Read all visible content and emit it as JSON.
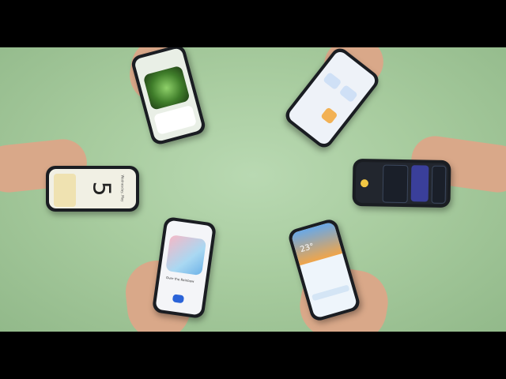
{
  "scene": {
    "description_label": "six-phones-on-green-background",
    "background_color": "#a9cda0",
    "letterbox_color": "#000000"
  },
  "phones": {
    "clock": {
      "big_digit": "5",
      "label": "Wednesday, May"
    },
    "weather": {
      "temperature": "23°"
    },
    "music": {
      "track": "Over the Rainbow"
    }
  }
}
